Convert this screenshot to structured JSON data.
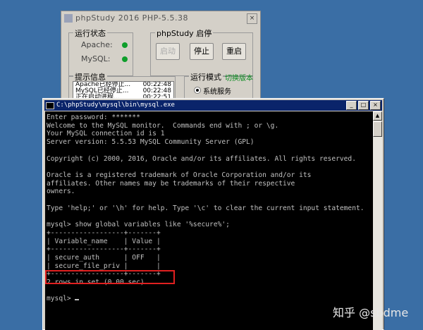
{
  "phpstudy": {
    "title": "phpStudy 2016    PHP-5.5.38",
    "close": "×",
    "status_group": "运行状态",
    "apache": "Apache:",
    "mysql": "MySQL:",
    "control_group": "phpStudy 启停",
    "btn_start": "启动",
    "btn_stop": "停止",
    "btn_restart": "重启",
    "log_group": "提示信息",
    "log": [
      {
        "msg": "Apache已经停止...",
        "time": "00:22:48"
      },
      {
        "msg": "MySQL已经停止...",
        "time": "00:22:48"
      },
      {
        "msg": "正在启动进程...",
        "time": "00:22:51"
      }
    ],
    "mode_group": "运行模式",
    "switch_version": "切换版本",
    "mode_service": "系统服务",
    "status_color": "#0e9e2b"
  },
  "cmd": {
    "title": "C:\\phpStudy\\mysql\\bin\\mysql.exe",
    "min": "_",
    "max": "□",
    "close": "×",
    "lines": [
      "Enter password: *******",
      "Welcome to the MySQL monitor.  Commands end with ; or \\g.",
      "Your MySQL connection id is 1",
      "Server version: 5.5.53 MySQL Community Server (GPL)",
      "",
      "Copyright (c) 2000, 2016, Oracle and/or its affiliates. All rights reserved.",
      "",
      "Oracle is a registered trademark of Oracle Corporation and/or its",
      "affiliates. Other names may be trademarks of their respective",
      "owners.",
      "",
      "Type 'help;' or '\\h' for help. Type '\\c' to clear the current input statement.",
      "",
      "mysql> show global variables like '%secure%';",
      "+------------------+-------+",
      "| Variable_name    | Value |",
      "+------------------+-------+",
      "| secure_auth      | OFF   |",
      "| secure_file_priv |       |",
      "+------------------+-------+",
      "2 rows in set (0.00 sec)",
      "",
      "mysql> "
    ]
  },
  "watermark": "知乎 @sbdme"
}
